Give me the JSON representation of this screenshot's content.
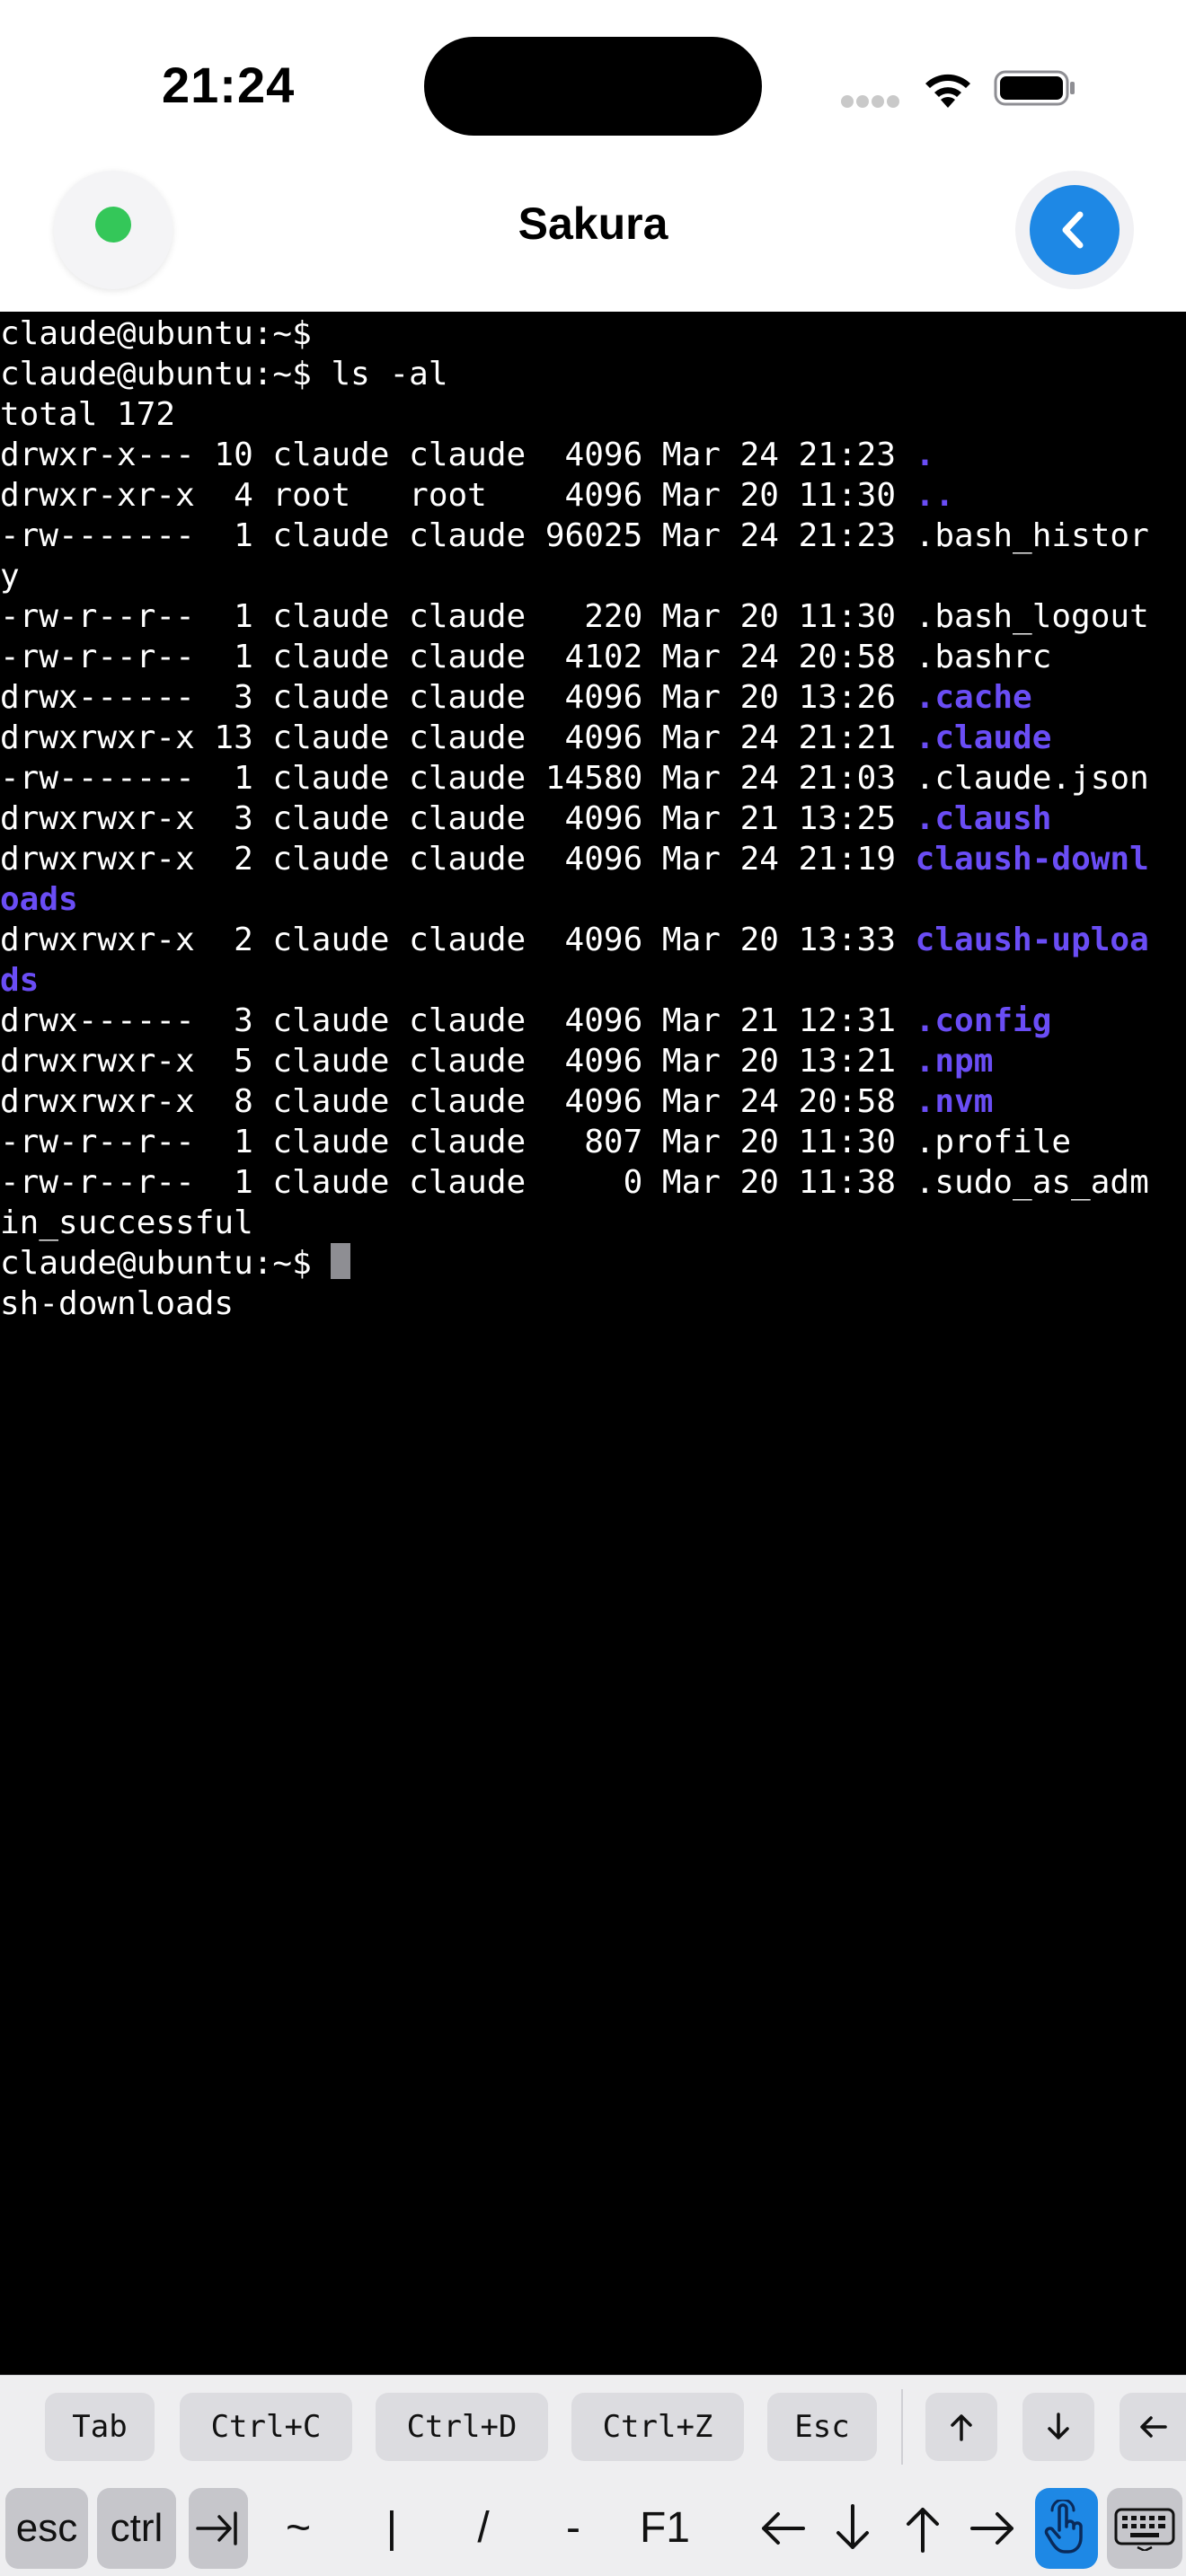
{
  "status_bar": {
    "time": "21:24"
  },
  "nav": {
    "title": "Sakura",
    "connection_status": "connected",
    "status_color": "#34c759",
    "back_icon": "chevron-left-icon",
    "accent": "#1e88e5"
  },
  "terminal": {
    "lines": [
      {
        "text": "claude@ubuntu:~$",
        "style": "plain"
      },
      {
        "text": "claude@ubuntu:~$ ls -al",
        "style": "plain"
      },
      {
        "text": "total 172",
        "style": "plain"
      },
      {
        "prefix": "drwxr-x--- 10 claude claude  4096 Mar 24 21:23 ",
        "name": ".",
        "style": "dir"
      },
      {
        "prefix": "drwxr-xr-x  4 root   root    4096 Mar 20 11:30 ",
        "name": "..",
        "style": "dir"
      },
      {
        "text": "-rw-------  1 claude claude 96025 Mar 24 21:23 .bash_histor",
        "style": "plain"
      },
      {
        "text": "y",
        "style": "plain"
      },
      {
        "text": "-rw-r--r--  1 claude claude   220 Mar 20 11:30 .bash_logout",
        "style": "plain"
      },
      {
        "text": "-rw-r--r--  1 claude claude  4102 Mar 24 20:58 .bashrc",
        "style": "plain"
      },
      {
        "prefix": "drwx------  3 claude claude  4096 Mar 20 13:26 ",
        "name": ".cache",
        "style": "dir"
      },
      {
        "prefix": "drwxrwxr-x 13 claude claude  4096 Mar 24 21:21 ",
        "name": ".claude",
        "style": "dir"
      },
      {
        "text": "-rw-------  1 claude claude 14580 Mar 24 21:03 .claude.json",
        "style": "plain"
      },
      {
        "prefix": "drwxrwxr-x  3 claude claude  4096 Mar 21 13:25 ",
        "name": ".claush",
        "style": "dir"
      },
      {
        "prefix": "drwxrwxr-x  2 claude claude  4096 Mar 24 21:19 ",
        "name": "claush-downl",
        "style": "dir"
      },
      {
        "text": "oads",
        "style": "dirwrap"
      },
      {
        "prefix": "drwxrwxr-x  2 claude claude  4096 Mar 20 13:33 ",
        "name": "claush-uploa",
        "style": "dir"
      },
      {
        "text": "ds",
        "style": "dirwrap"
      },
      {
        "prefix": "drwx------  3 claude claude  4096 Mar 21 12:31 ",
        "name": ".config",
        "style": "dir"
      },
      {
        "prefix": "drwxrwxr-x  5 claude claude  4096 Mar 20 13:21 ",
        "name": ".npm",
        "style": "dir"
      },
      {
        "prefix": "drwxrwxr-x  8 claude claude  4096 Mar 24 20:58 ",
        "name": ".nvm",
        "style": "dir"
      },
      {
        "text": "-rw-r--r--  1 claude claude   807 Mar 20 11:30 .profile",
        "style": "plain"
      },
      {
        "text": "-rw-r--r--  1 claude claude     0 Mar 20 11:38 .sudo_as_adm",
        "style": "plain"
      },
      {
        "text": "in_successful",
        "style": "plain"
      },
      {
        "text": "claude@ubuntu:~$ ",
        "style": "prompt"
      },
      {
        "text": "sh-downloads",
        "style": "plain"
      }
    ],
    "colors": {
      "foreground": "#ffffff",
      "background": "#000000",
      "directory": "#6a4df5",
      "cursor": "#8e8e93"
    }
  },
  "shortcut_bar": {
    "keys": [
      "Tab",
      "Ctrl+C",
      "Ctrl+D",
      "Ctrl+Z",
      "Esc"
    ],
    "arrow_keys": [
      "arrow-up-icon",
      "arrow-down-icon",
      "arrow-left-icon"
    ]
  },
  "accessory_bar": {
    "esc": "esc",
    "ctrl": "ctrl",
    "tab_icon": "tab-arrow-icon",
    "tilde": "~",
    "pipe": "|",
    "slash": "/",
    "dash": "-",
    "f1": "F1",
    "arrows": [
      "arrow-left-icon",
      "arrow-down-icon",
      "arrow-up-icon",
      "arrow-right-icon"
    ],
    "touch_icon": "hand-pointer-icon",
    "keyboard_icon": "keyboard-icon"
  }
}
